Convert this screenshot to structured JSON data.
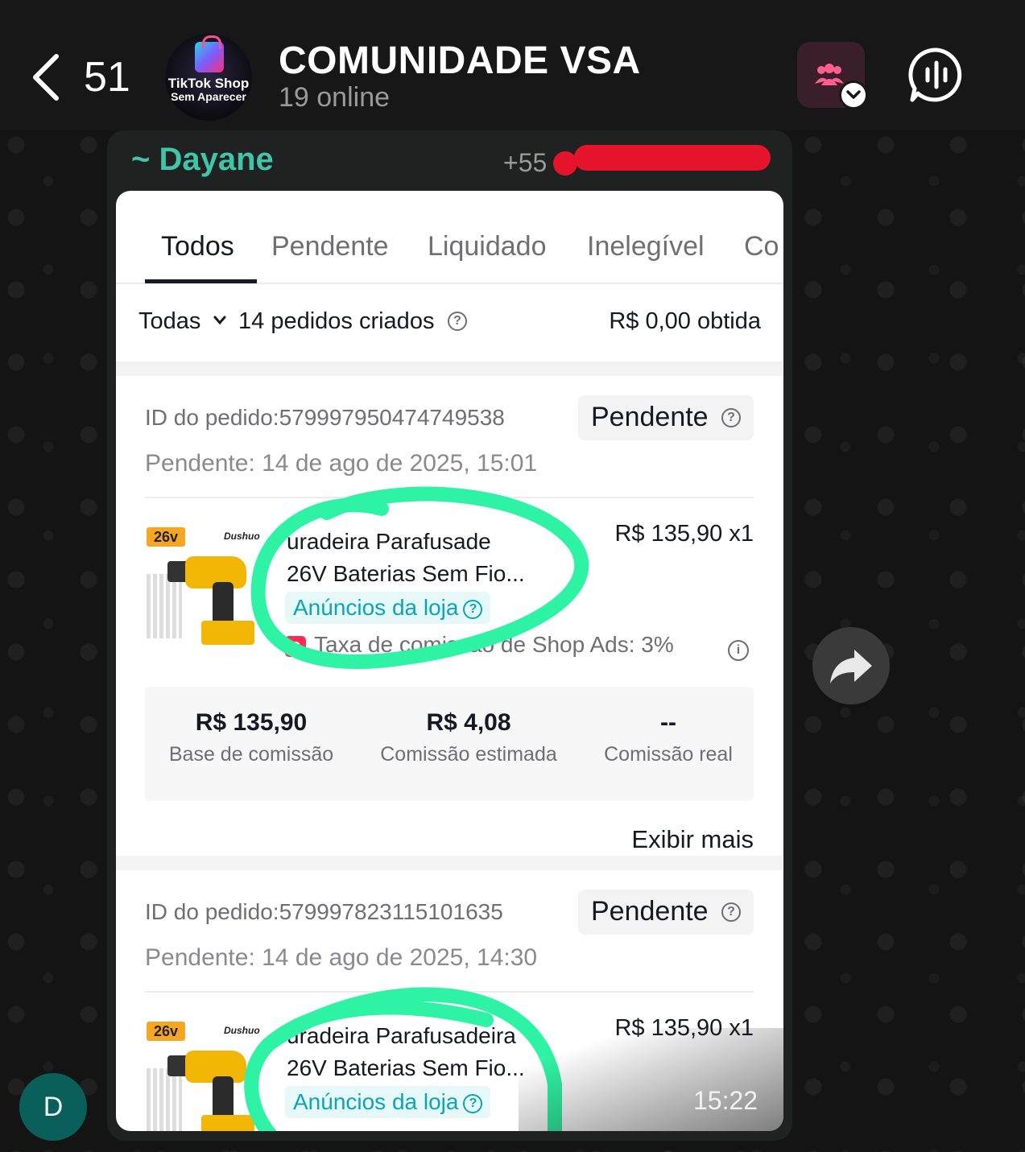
{
  "header": {
    "back_count": "51",
    "group_avatar_line1": "TikTok Shop",
    "group_avatar_line2": "Sem Aparecer",
    "title": "COMUNIDADE VSA",
    "subtitle": "19 online"
  },
  "message": {
    "sender": "~ Dayane",
    "sender_phone": "+55",
    "timestamp": "15:22",
    "screenshot": {
      "tabs": [
        "Todos",
        "Pendente",
        "Liquidado",
        "Inelegível",
        "Co"
      ],
      "active_tab": "Todos",
      "filter": {
        "selected": "Todas",
        "orders_created": "14 pedidos criados",
        "earned": "R$ 0,00 obtida"
      },
      "orders": [
        {
          "id": "ID do pedido:579997950474749538",
          "status": "Pendente",
          "date": "Pendente: 14 de ago de 2025, 15:01",
          "product_line1": "uradeira Parafusade",
          "product_line2": "26V Baterias Sem Fio...",
          "ads_badge": "Anúncios da loja",
          "price": "R$ 135,90 x1",
          "fee": "Taxa de comissão de Shop Ads: 3%",
          "commission_base": "R$ 135,90",
          "commission_base_label": "Base de comissão",
          "commission_estimated": "R$ 4,08",
          "commission_estimated_label": "Comissão estimada",
          "commission_real": "--",
          "commission_real_label": "Comissão real",
          "show_more": "Exibir mais",
          "image_tag": "26v",
          "image_brand": "Dushuo"
        },
        {
          "id": "ID do pedido:579997823115101635",
          "status": "Pendente",
          "date": "Pendente: 14 de ago de 2025, 14:30",
          "product_line1": "uradeira Parafusadeira",
          "product_line2": "26V Baterias Sem Fio...",
          "ads_badge": "Anúncios da loja",
          "price": "R$ 135,90 x1",
          "image_tag": "26v",
          "image_brand": "Dushuo"
        }
      ]
    }
  },
  "user_avatar_letter": "D",
  "colors": {
    "sender": "#40c4aa",
    "highlight_scribble": "#2ef2a4",
    "redaction": "#e5142a",
    "ads_badge": "#0aa6b6"
  },
  "icons": [
    "back-chevron-icon",
    "people-icon",
    "chevron-down-icon",
    "voice-chat-icon",
    "forward-icon",
    "help-icon",
    "info-icon"
  ]
}
